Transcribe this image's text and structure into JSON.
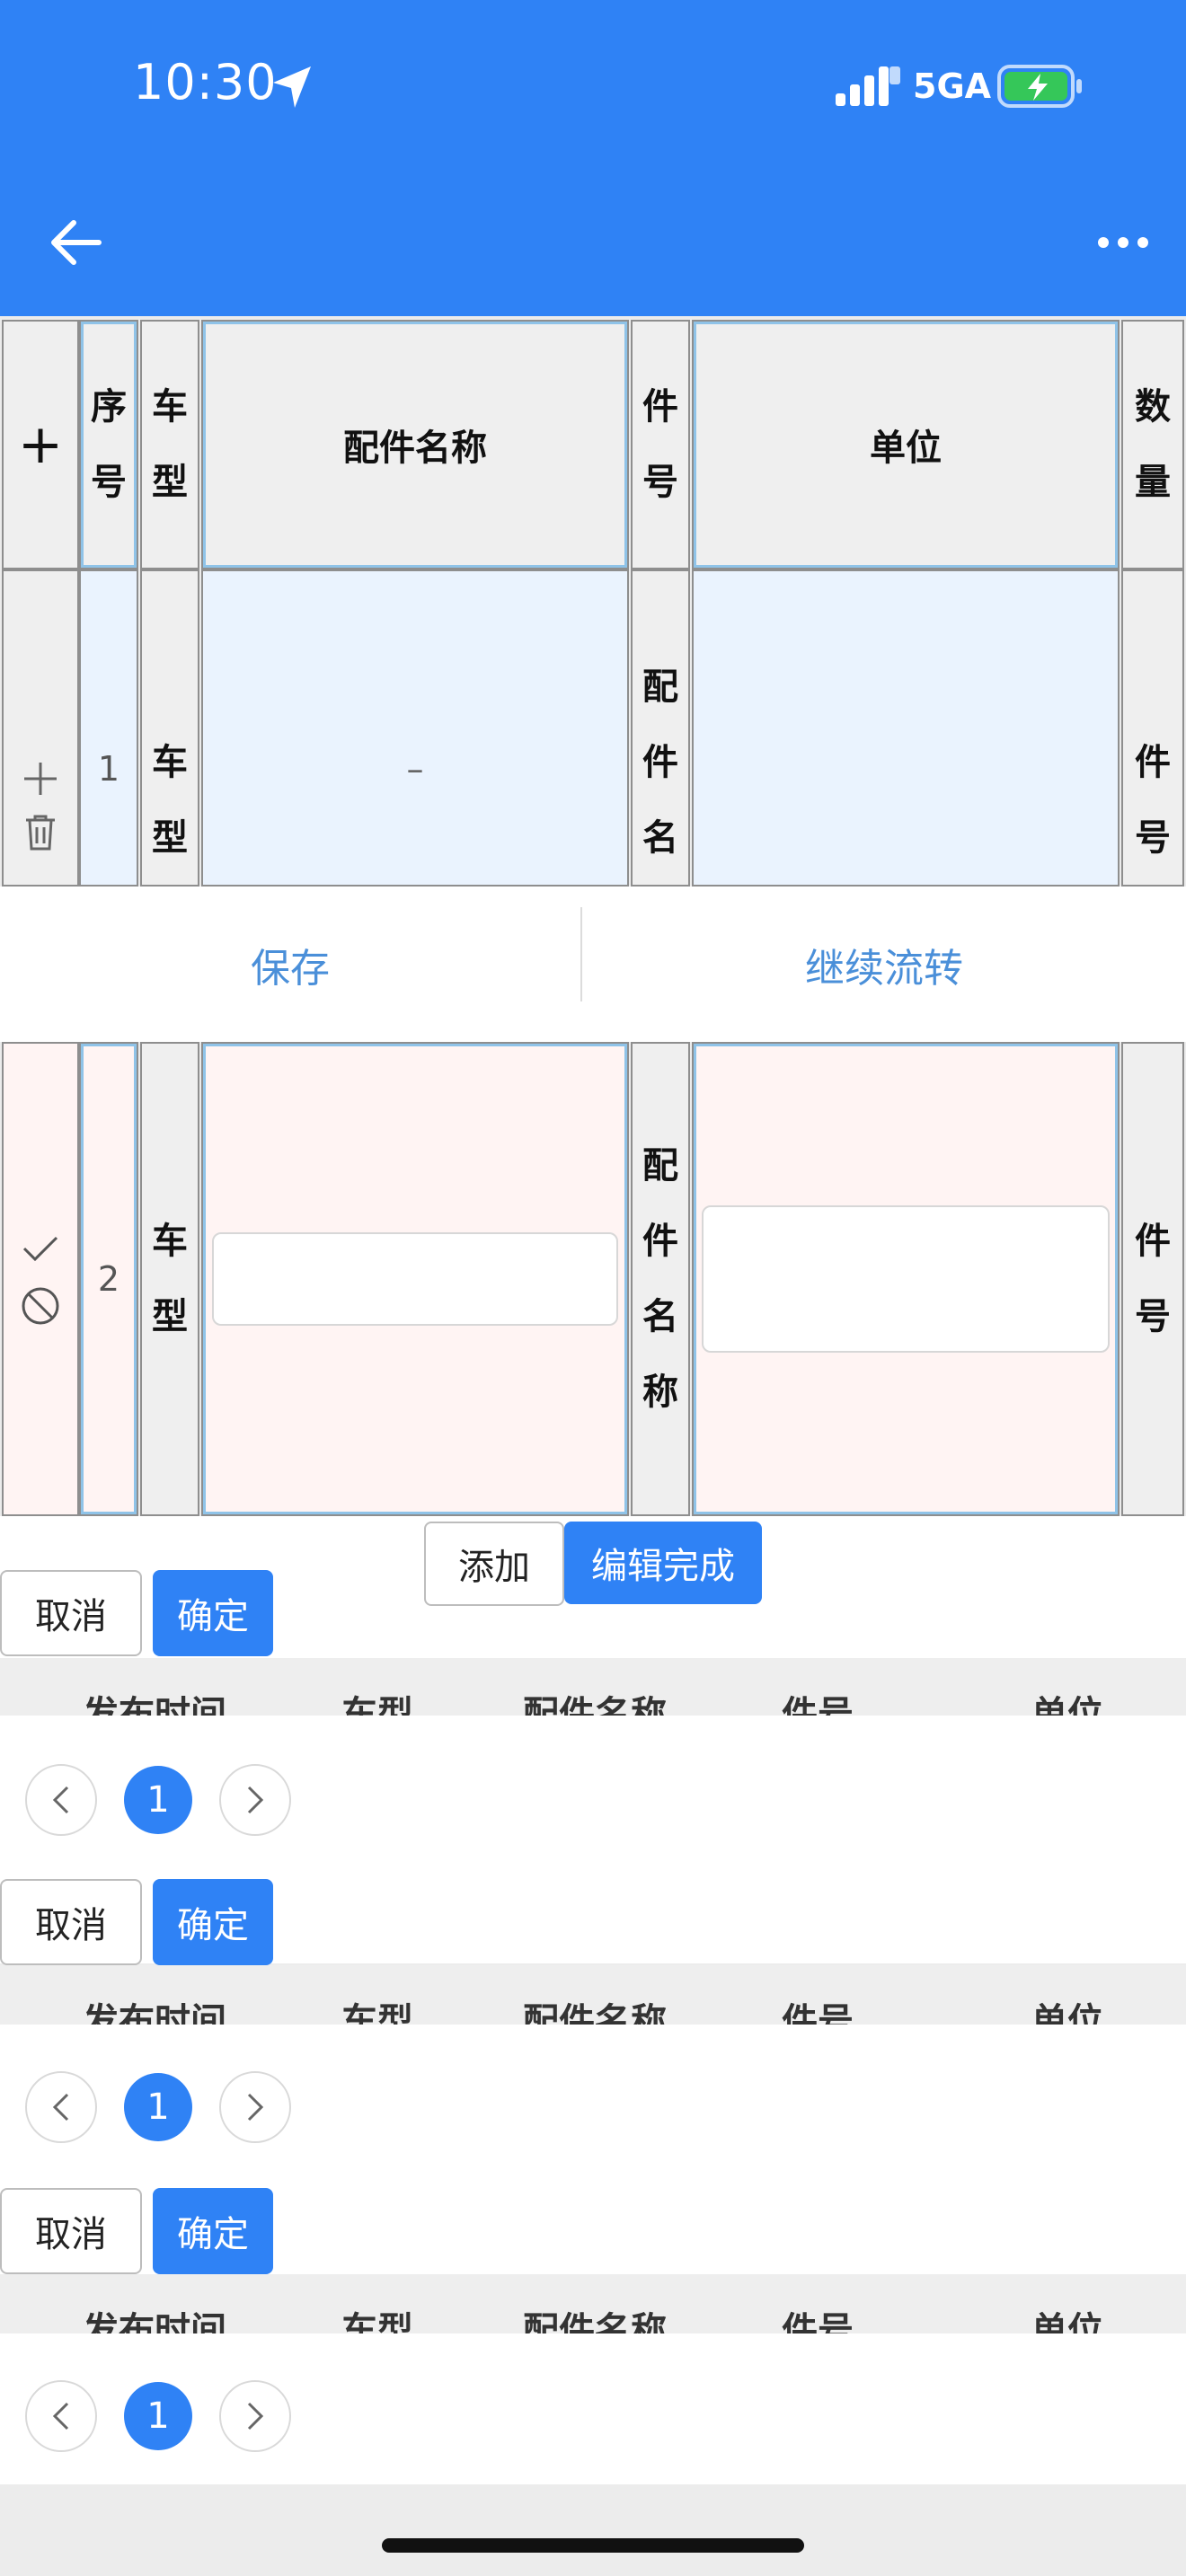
{
  "status_bar": {
    "time": "10:30",
    "network": "5GA"
  },
  "table": {
    "headers": {
      "add": "+",
      "seq": "序号",
      "model": "车型",
      "part_name": "配件名称",
      "part_no": "件号",
      "unit": "单位",
      "qty": "数量"
    },
    "row1": {
      "seq": "1",
      "model": "车型",
      "part_name": "–",
      "part_no": "配件名",
      "qty": "件号"
    },
    "row2": {
      "seq": "2",
      "model": "车型",
      "part_no": "配件名称",
      "qty": "件号"
    }
  },
  "action_bar": {
    "save": "保存",
    "continue": "继续流转"
  },
  "edit_actions": {
    "add": "添加",
    "done": "编辑完成"
  },
  "dialog": {
    "cancel": "取消",
    "confirm": "确定",
    "columns": [
      "发布时间",
      "车型",
      "配件名称",
      "件号",
      "单位"
    ],
    "page": "1"
  }
}
